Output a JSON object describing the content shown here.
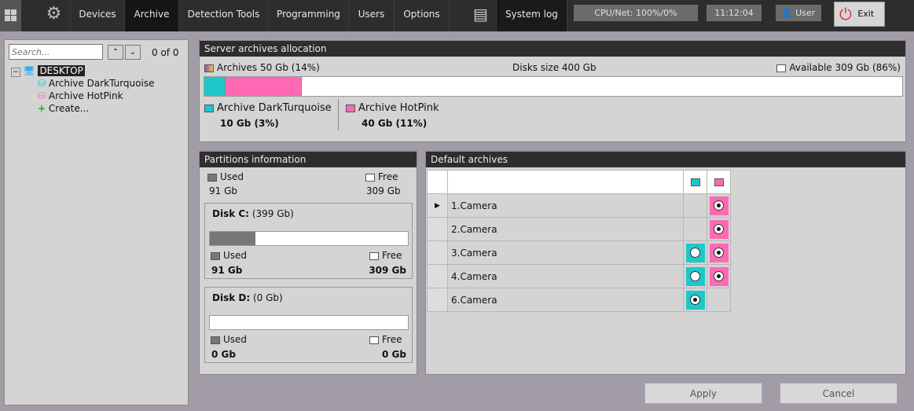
{
  "nav": {
    "items": [
      "Devices",
      "Archive",
      "Detection Tools",
      "Programming",
      "Users",
      "Options"
    ],
    "system_log": "System log",
    "cpu": "CPU/Net: 100%/0%",
    "time": "11:12:04",
    "user": "User",
    "exit": "Exit"
  },
  "tree": {
    "search_placeholder": "Search...",
    "count": "0 of 0",
    "root": "DESKTOP",
    "items": [
      "Archive DarkTurquoise",
      "Archive HotPink",
      "Create..."
    ]
  },
  "allocation": {
    "title": "Server archives allocation",
    "archives": "Archives 50 Gb (14%)",
    "disks": "Disks size 400 Gb",
    "available": "Available 309 Gb (86%)",
    "segments": [
      {
        "name": "Archive DarkTurquoise",
        "size": "10 Gb (3%)",
        "percent": 3,
        "color": "#1ec8c8"
      },
      {
        "name": "Archive HotPink",
        "size": "40 Gb (11%)",
        "percent": 11,
        "color": "#ff69b4"
      }
    ]
  },
  "partitions": {
    "title": "Partitions information",
    "used": "Used",
    "free": "Free",
    "used_val": "91 Gb",
    "free_val": "309 Gb",
    "disks": [
      {
        "name": "Disk C:",
        "size": "(399 Gb)",
        "used": "Used",
        "free": "Free",
        "used_val": "91 Gb",
        "free_val": "309 Gb",
        "used_percent": 23
      },
      {
        "name": "Disk D:",
        "size": "(0 Gb)",
        "used": "Used",
        "free": "Free",
        "used_val": "0 Gb",
        "free_val": "0 Gb",
        "used_percent": 0
      }
    ]
  },
  "defaults": {
    "title": "Default archives",
    "rows": [
      {
        "camera": "1.Camera",
        "turq": null,
        "pink": true
      },
      {
        "camera": "2.Camera",
        "turq": null,
        "pink": true
      },
      {
        "camera": "3.Camera",
        "turq": false,
        "pink": true
      },
      {
        "camera": "4.Camera",
        "turq": false,
        "pink": true
      },
      {
        "camera": "6.Camera",
        "turq": true,
        "pink": null
      }
    ]
  },
  "buttons": {
    "apply": "Apply",
    "cancel": "Cancel"
  }
}
